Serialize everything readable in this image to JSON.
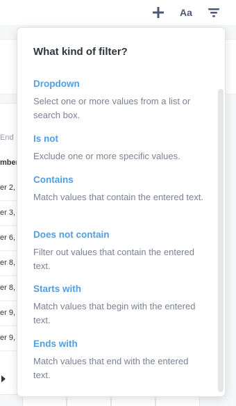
{
  "toolbar": {
    "add_icon": "plus-icon",
    "text_button_label": "Aa",
    "filter_icon": "filter-icon"
  },
  "background_table": {
    "header_cell": "End",
    "column_label": "mber",
    "rows": [
      "er 2,",
      "er 3,",
      "er 6,",
      "er 8,",
      "er 8,",
      "er 9,",
      "er 9,"
    ]
  },
  "filter_popover": {
    "title": "What kind of filter?",
    "options": [
      {
        "name": "Dropdown",
        "description": "Select one or more values from a list or search box."
      },
      {
        "name": "Is not",
        "description": "Exclude one or more specific values."
      },
      {
        "name": "Contains",
        "description": "Match values that contain the entered text."
      },
      {
        "name": "Does not contain",
        "description": "Filter out values that contain the entered text."
      },
      {
        "name": "Starts with",
        "description": "Match values that begin with the entered text."
      },
      {
        "name": "Ends with",
        "description": "Match values that end with the entered text."
      }
    ]
  },
  "colors": {
    "accent": "#509ee3",
    "title": "#2e353b",
    "description": "#7b8193"
  }
}
